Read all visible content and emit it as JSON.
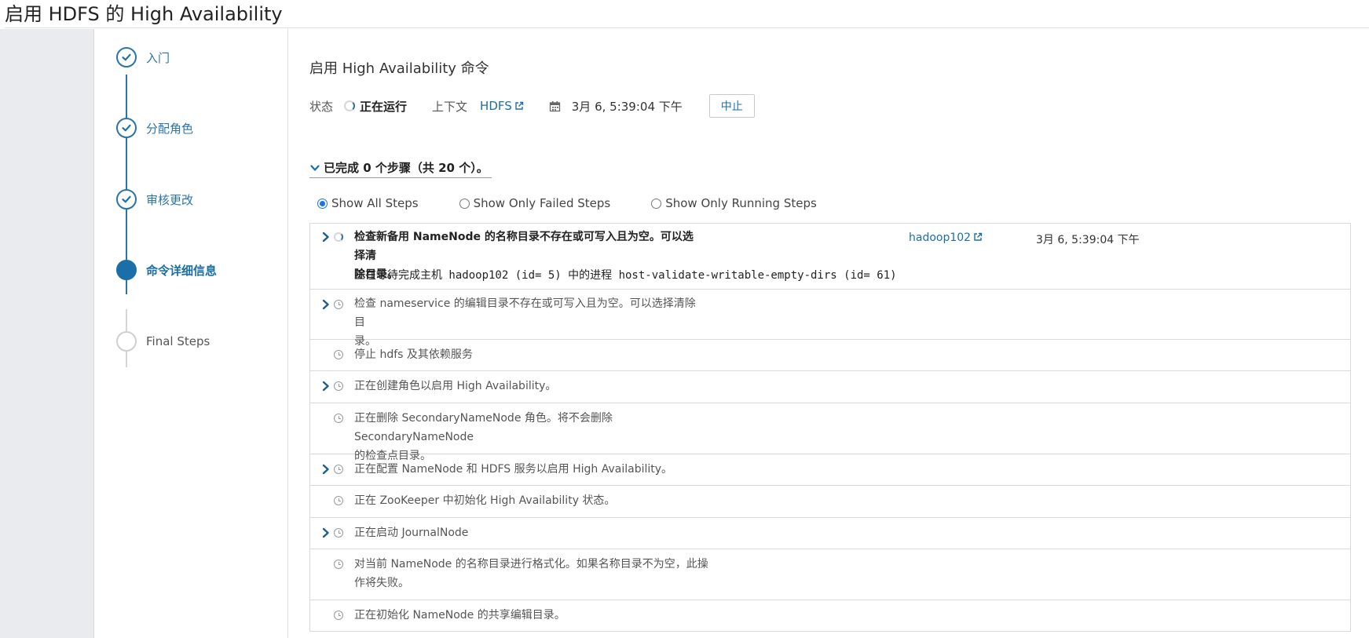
{
  "page": {
    "title": "启用 HDFS 的 High Availability"
  },
  "wizard": {
    "steps": [
      {
        "label": "入门",
        "state": "done"
      },
      {
        "label": "分配角色",
        "state": "done"
      },
      {
        "label": "审核更改",
        "state": "done"
      },
      {
        "label": "命令详细信息",
        "state": "active"
      },
      {
        "label": "Final Steps",
        "state": "pending"
      }
    ]
  },
  "command": {
    "title": "启用 High Availability 命令",
    "status_label": "状态",
    "status_value": "正在运行",
    "context_label": "上下文",
    "context_link": "HDFS",
    "datetime": "3月 6, 5:39:04 下午",
    "abort_label": "中止",
    "summary": "已完成 0 个步骤（共 20 个）。"
  },
  "filters": {
    "options": [
      "Show All Steps",
      "Show Only Failed Steps",
      "Show Only Running Steps"
    ],
    "selected": "Show All Steps"
  },
  "steps": [
    {
      "line1": "检查新备用 NameNode 的名称目录不存在或可写入且为空。可以选择清",
      "line2": "除目录。",
      "detail": "正在等待完成主机 hadoop102 (id= 5) 中的进程 host-validate-writable-empty-dirs (id= 61)",
      "host": "hadoop102",
      "time": "3月 6, 5:39:04 下午",
      "expandable": true,
      "status": "running"
    },
    {
      "line1": "检查 nameservice 的编辑目录不存在或可写入且为空。可以选择清除目",
      "line2": "录。",
      "expandable": true,
      "status": "pending"
    },
    {
      "line1": "停止 hdfs 及其依赖服务",
      "expandable": false,
      "status": "pending"
    },
    {
      "line1": "正在创建角色以启用 High Availability。",
      "expandable": true,
      "status": "pending"
    },
    {
      "line1": "正在删除 SecondaryNameNode 角色。将不会删除 SecondaryNameNode",
      "line2": "的检查点目录。",
      "expandable": false,
      "status": "pending"
    },
    {
      "line1": "正在配置 NameNode 和 HDFS 服务以启用 High Availability。",
      "expandable": true,
      "status": "pending"
    },
    {
      "line1": "正在 ZooKeeper 中初始化 High Availability 状态。",
      "expandable": false,
      "status": "pending"
    },
    {
      "line1": "正在启动 JournalNode",
      "expandable": true,
      "status": "pending"
    },
    {
      "line1": "对当前 NameNode 的名称目录进行格式化。如果名称目录不为空，此操",
      "line2": "作将失败。",
      "expandable": false,
      "status": "pending"
    },
    {
      "line1": "正在初始化 NameNode 的共享编辑目录。",
      "expandable": false,
      "status": "pending"
    }
  ],
  "colors": {
    "accent": "#1a6fa8",
    "link": "#1a6fa8",
    "border": "#d9d9d9"
  },
  "icons": {
    "done": "check-icon",
    "running": "spinner-icon",
    "pending": "clock-icon",
    "expand": "chevron-right-icon",
    "external": "external-link-icon",
    "calendar": "calendar-icon"
  }
}
